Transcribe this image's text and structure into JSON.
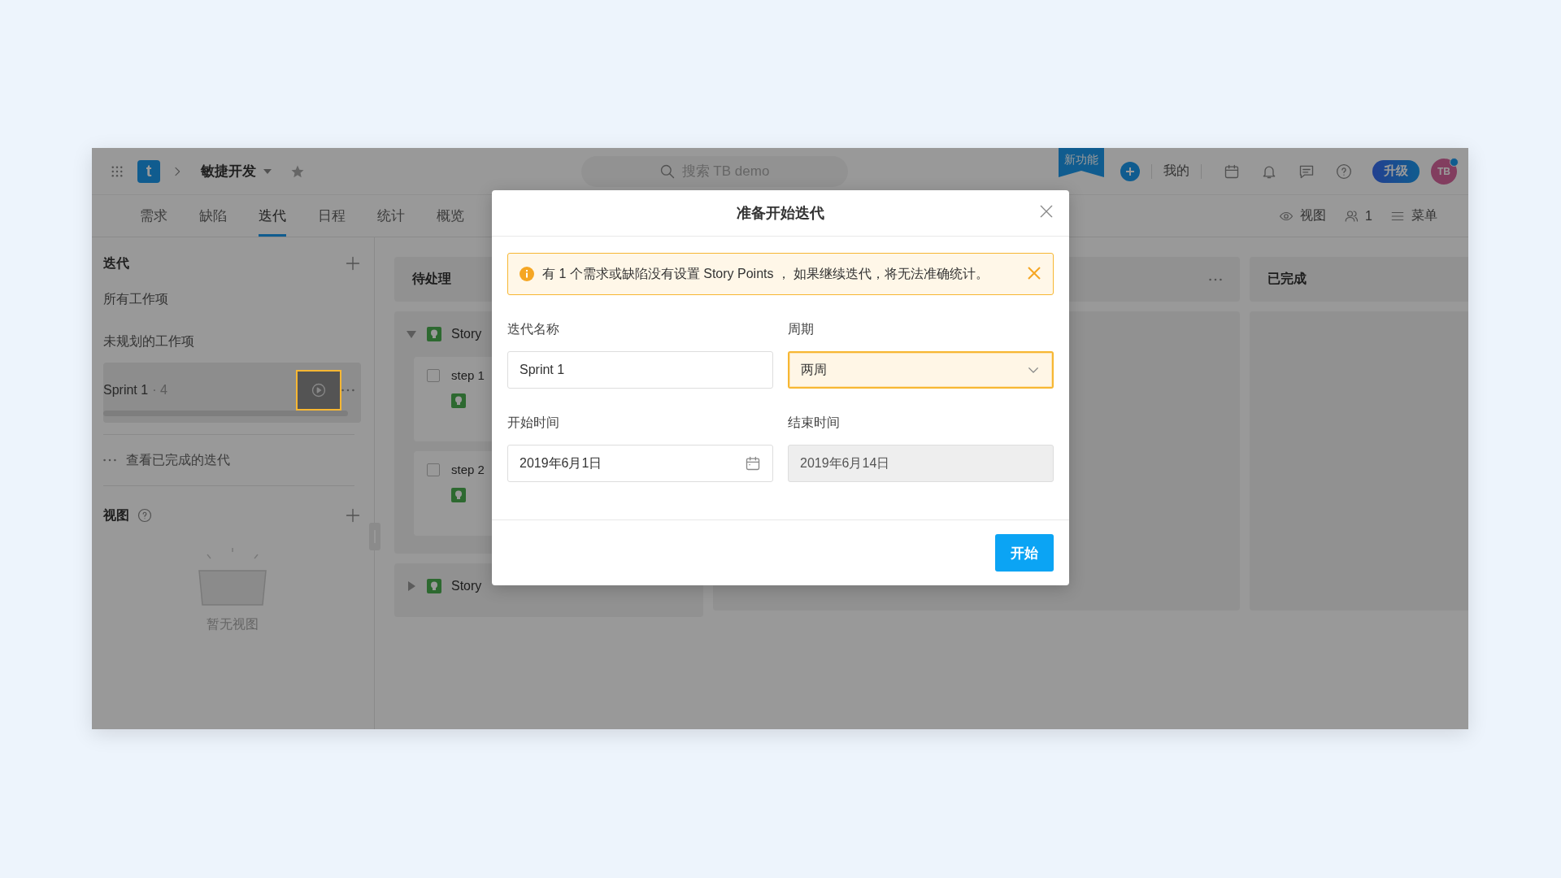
{
  "topbar": {
    "logo": "t",
    "project": "敏捷开发",
    "search": {
      "placeholder": "搜索 TB demo"
    },
    "new_feature_badge": "新功能",
    "my_link": "我的",
    "upgrade_button": "升级",
    "avatar": "TB"
  },
  "tabs": [
    {
      "label": "需求",
      "selected": false
    },
    {
      "label": "缺陷",
      "selected": false
    },
    {
      "label": "迭代",
      "selected": true
    },
    {
      "label": "日程",
      "selected": false
    },
    {
      "label": "统计",
      "selected": false
    },
    {
      "label": "概览",
      "selected": false
    }
  ],
  "view_tools": [
    {
      "kind": "view",
      "label": "视图"
    },
    {
      "kind": "members",
      "label": "1"
    },
    {
      "kind": "menu",
      "label": "菜单"
    }
  ],
  "sidebar": {
    "iteration_header": "迭代",
    "items": [
      {
        "label": "所有工作项",
        "selected": false
      },
      {
        "label": "未规划的工作项",
        "selected": false
      }
    ],
    "sprint": {
      "name": "Sprint 1",
      "count": "· 4",
      "selected": true,
      "highlighted": true
    },
    "completed_link": "查看已完成的迭代",
    "views_header": "视图",
    "empty_text": "暂无视图"
  },
  "board": {
    "columns": [
      {
        "title": "待处理",
        "groups": [
          {
            "title": "Story",
            "expanded": true,
            "cards": [
              {
                "title": "step 1",
                "checked": false
              },
              {
                "title": "step 2",
                "checked": false
              }
            ]
          },
          {
            "title": "Story",
            "expanded": false
          }
        ]
      },
      {
        "title": "已完成"
      }
    ]
  },
  "dialog": {
    "title": "准备开始迭代",
    "alert": "有 1 个需求或缺陷没有设置 Story Points ， 如果继续迭代，将无法准确统计。",
    "fields": [
      {
        "kind": "text",
        "label": "迭代名称",
        "value": "Sprint 1"
      },
      {
        "kind": "select",
        "label": "周期",
        "value": "两周",
        "highlighted": true
      },
      {
        "kind": "date",
        "label": "开始时间",
        "value": "2019年6月1日"
      },
      {
        "kind": "date",
        "label": "结束时间",
        "value": "2019年6月14日",
        "disabled": true
      }
    ],
    "primary_button": "开始"
  }
}
